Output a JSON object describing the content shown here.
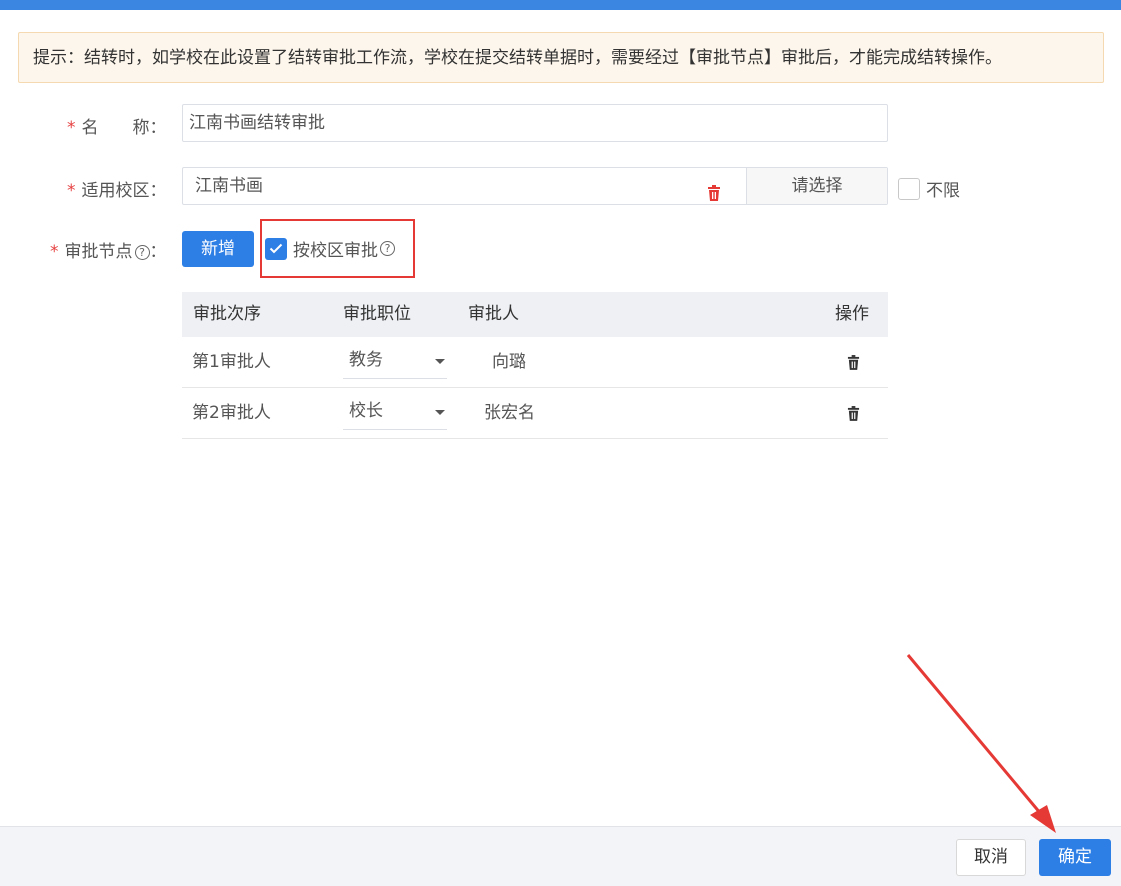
{
  "tip": "提示：结转时，如学校在此设置了结转审批工作流，学校在提交结转单据时，需要经过【审批节点】审批后，才能完成结转操作。",
  "form": {
    "required_mark": "*",
    "name_label": "名　　称：",
    "name_value": "江南书画结转审批",
    "campus_label": "适用校区：",
    "campus_value": "江南书画",
    "campus_select": "请选择",
    "unlimited_label": "不限",
    "node_label": "审批节点",
    "node_suffix": "：",
    "add_button": "新增",
    "by_campus_label": "按校区审批",
    "help_glyph": "?"
  },
  "table": {
    "headers": [
      "审批次序",
      "审批职位",
      "审批人",
      "操作"
    ],
    "rows": [
      {
        "order": "第1审批人",
        "position": "教务",
        "approver": "向璐"
      },
      {
        "order": "第2审批人",
        "position": "校长",
        "approver": "张宏名"
      }
    ]
  },
  "footer": {
    "cancel": "取消",
    "ok": "确定"
  },
  "colors": {
    "primary": "#2d7ee5",
    "highlight": "#e53935"
  }
}
